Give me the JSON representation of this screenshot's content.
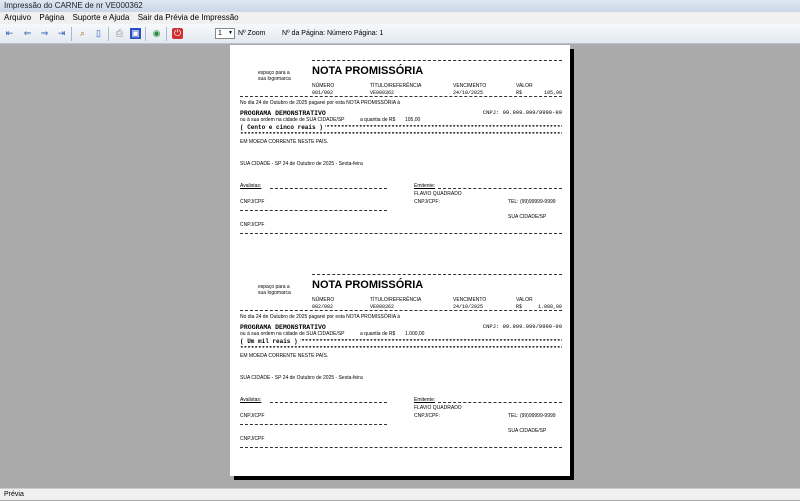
{
  "window": {
    "title": "Impressão do CARNE de nr VE000362"
  },
  "menu": [
    "Arquivo",
    "Página",
    "Suporte e Ajuda",
    "Sair da Prévia de Impressão"
  ],
  "toolbar": {
    "zoom_value": "1",
    "zoom_label": "Nº Zoom",
    "page_label": "Nº da Página: Número Página: 1",
    "icons": [
      "first-page-icon",
      "prev-page-icon",
      "next-page-icon",
      "last-page-icon",
      "search-icon",
      "two-pages-icon",
      "print-icon",
      "export-icon",
      "globe-icon",
      "close-icon"
    ]
  },
  "notes": [
    {
      "logo_line1": "espaço para a",
      "logo_line2": "sua logomarca",
      "title": "NOTA PROMISSÓRIA",
      "h_numero": "NÚMERO",
      "h_titulo": "TÍTULO/REFERÊNCIA",
      "h_venc": "VENCIMENTO",
      "h_valor": "VALOR",
      "numero": "001/002",
      "titulo": "VE000362",
      "vencimento": "24/10/2025",
      "moeda": "R$",
      "valor": "105,00",
      "line1": "No dia 24 de Outubro de 2025 pagarei por esta NOTA PROMISSÓRIA à",
      "beneficiario": "PROGRAMA DEMONSTRATIVO",
      "cnpj": "CNPJ: 99.999.999/9999-99",
      "ordem": "ou à sua ordem na cidade de SUA CIDADE/SP",
      "quantia_label": "a quantia de R$",
      "quantia": "105,00",
      "extenso": "( Cento e cinco reais )",
      "moeda_text": "EM MOEDA CORRENTE NESTE PAÍS.",
      "data_local": "SUA CIDADE - SP 24 de Outubro de 2025 - Sexta-feira",
      "avalistas": "Avalistas:",
      "emitente_label": "Emitente:",
      "emitente": "FLAVIO QUADRADO",
      "cnpjcpf1": "CNPJ/CPF",
      "cnpjcpf_emit": "CNPJ/CPF:",
      "tel": "TEL: (99)99999-9999",
      "cidade": "SUA CIDADE/SP",
      "cnpjcpf2": "CNPJ/CPF"
    },
    {
      "logo_line1": "espaço para a",
      "logo_line2": "sua logomarca",
      "title": "NOTA PROMISSÓRIA",
      "h_numero": "NÚMERO",
      "h_titulo": "TÍTULO/REFERÊNCIA",
      "h_venc": "VENCIMENTO",
      "h_valor": "VALOR",
      "numero": "002/002",
      "titulo": "VE000362",
      "vencimento": "24/10/2025",
      "moeda": "R$",
      "valor": "1.000,00",
      "line1": "No dia 24 de Outubro de 2025 pagarei por esta NOTA PROMISSÓRIA à",
      "beneficiario": "PROGRAMA DEMONSTRATIVO",
      "cnpj": "CNPJ: 99.999.999/9999-99",
      "ordem": "ou à sua ordem na cidade de SUA CIDADE/SP",
      "quantia_label": "a quantia de R$",
      "quantia": "1.000,00",
      "extenso": "( Um mil reais )",
      "moeda_text": "EM MOEDA CORRENTE NESTE PAÍS.",
      "data_local": "SUA CIDADE - SP 24 de Outubro de 2025 - Sexta-feira",
      "avalistas": "Avalistas:",
      "emitente_label": "Emitente:",
      "emitente": "FLAVIO QUADRADO",
      "cnpjcpf1": "CNPJ/CPF",
      "cnpjcpf_emit": "CNPJ/CPF:",
      "tel": "TEL: (99)99999-9999",
      "cidade": "SUA CIDADE/SP",
      "cnpjcpf2": "CNPJ/CPF"
    }
  ],
  "status": "Prévia"
}
